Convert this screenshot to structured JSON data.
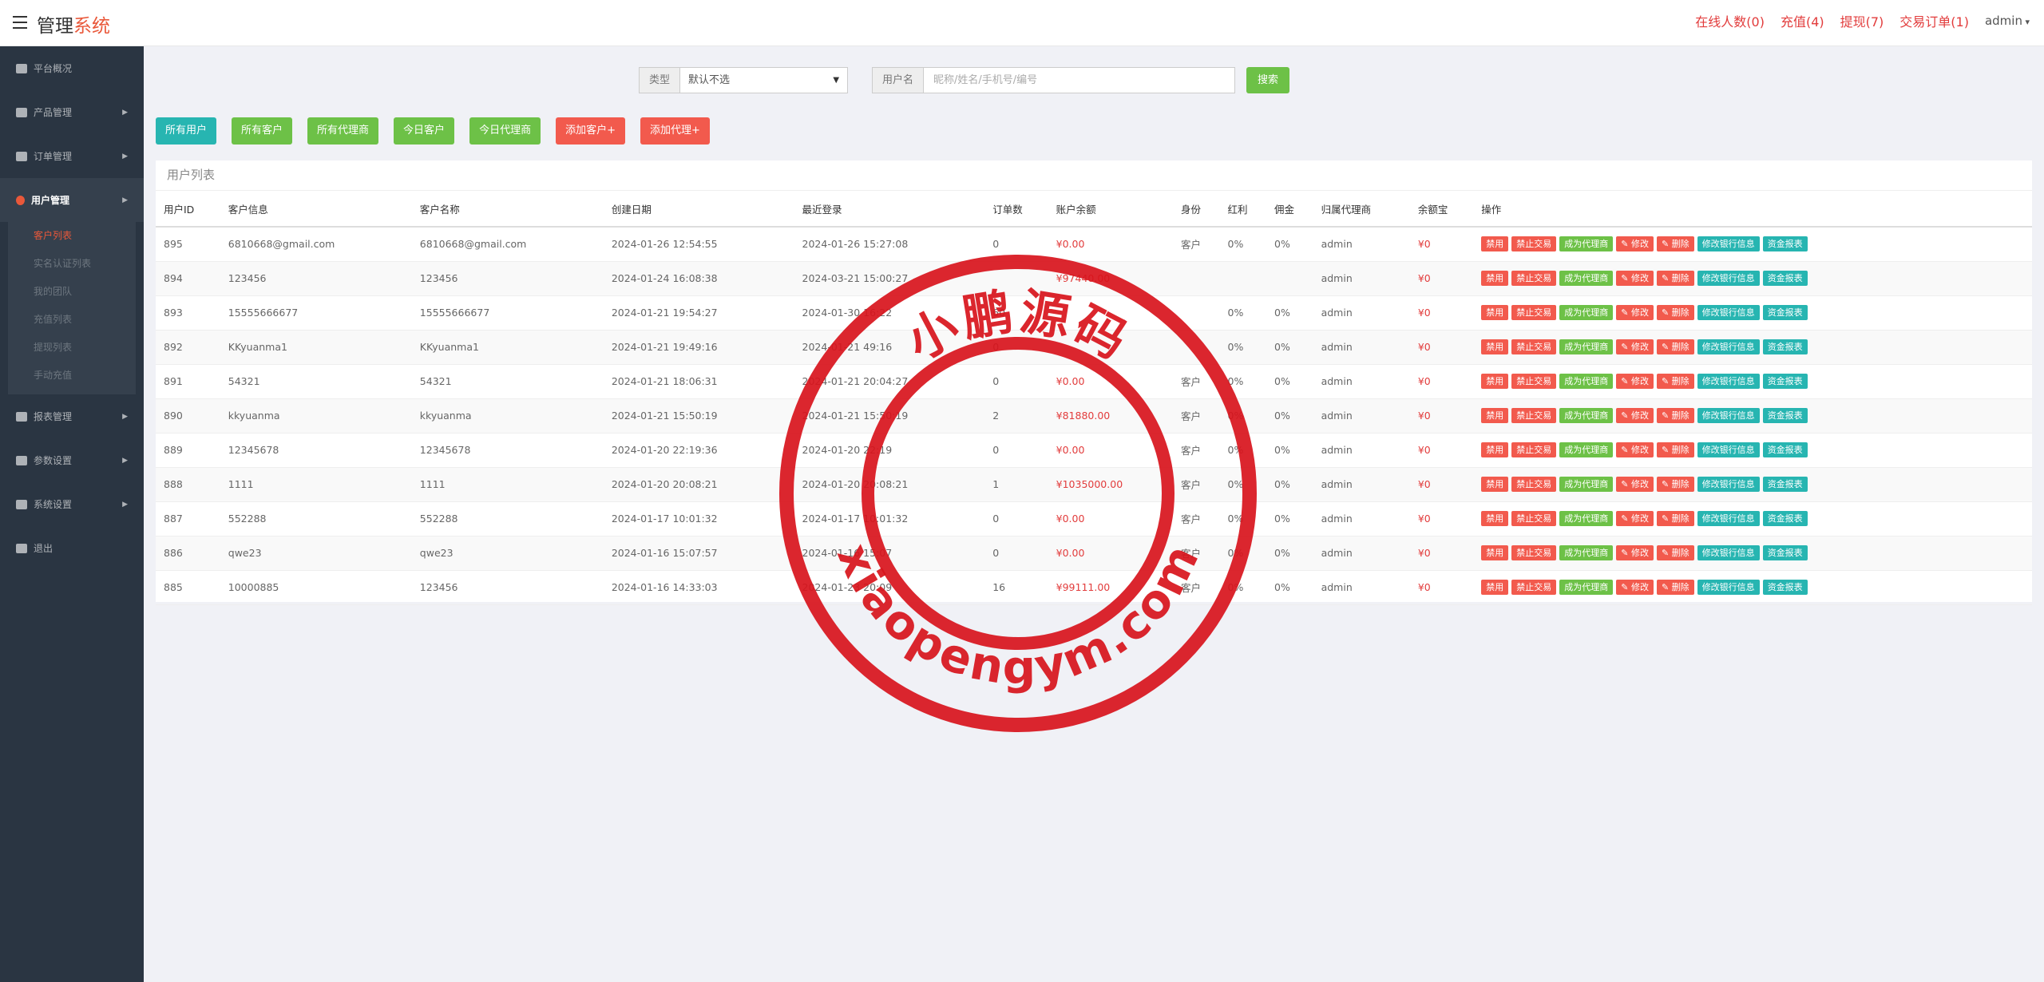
{
  "brand": {
    "main": "管理",
    "accent": "系统"
  },
  "top_links": [
    "在线人数(0)",
    "充值(4)",
    "提现(7)",
    "交易订单(1)"
  ],
  "user": "admin",
  "sidebar": [
    {
      "label": "平台概况",
      "icon": "dashboard-icon",
      "caret": false
    },
    {
      "label": "产品管理",
      "icon": "bitcoin-icon",
      "caret": true
    },
    {
      "label": "订单管理",
      "icon": "order-icon",
      "caret": true
    },
    {
      "label": "用户管理",
      "icon": "user-icon",
      "caret": true,
      "active": true,
      "children": [
        "客户列表",
        "实名认证列表",
        "我的团队",
        "充值列表",
        "提现列表",
        "手动充值"
      ]
    },
    {
      "label": "报表管理",
      "icon": "yen-icon",
      "caret": true
    },
    {
      "label": "参数设置",
      "icon": "params-icon",
      "caret": true
    },
    {
      "label": "系统设置",
      "icon": "gears-icon",
      "caret": true
    },
    {
      "label": "退出",
      "icon": "logout-icon",
      "caret": false
    }
  ],
  "search": {
    "type_label": "类型",
    "type_value": "默认不选",
    "name_label": "用户名",
    "name_placeholder": "昵称/姓名/手机号/编号",
    "button": "搜索"
  },
  "filters": [
    {
      "label": "所有用户",
      "color": "#27b5b1"
    },
    {
      "label": "所有客户",
      "color": "#6dc147"
    },
    {
      "label": "所有代理商",
      "color": "#6dc147"
    },
    {
      "label": "今日客户",
      "color": "#6dc147"
    },
    {
      "label": "今日代理商",
      "color": "#6dc147"
    },
    {
      "label": "添加客户+",
      "color": "#f25a4d"
    },
    {
      "label": "添加代理+",
      "color": "#f25a4d"
    }
  ],
  "table": {
    "title": "用户列表",
    "columns": [
      "用户ID",
      "客户信息",
      "客户名称",
      "创建日期",
      "最近登录",
      "订单数",
      "账户余额",
      "身份",
      "红利",
      "佣金",
      "归属代理商",
      "余额宝",
      "操作"
    ],
    "actions": [
      {
        "label": "禁用",
        "color": "#f25a4d"
      },
      {
        "label": "禁止交易",
        "color": "#f25a4d"
      },
      {
        "label": "成为代理商",
        "color": "#6dc147"
      },
      {
        "label": "✎ 修改",
        "color": "#f25a4d"
      },
      {
        "label": "✎ 删除",
        "color": "#f25a4d"
      },
      {
        "label": "修改银行信息",
        "color": "#27b5b1"
      },
      {
        "label": "资金报表",
        "color": "#27b5b1"
      }
    ],
    "rows": [
      [
        "895",
        "6810668@gmail.com",
        "6810668@gmail.com",
        "2024-01-26 12:54:55",
        "2024-01-26 15:27:08",
        "0",
        "¥0.00",
        "客户",
        "0%",
        "0%",
        "admin",
        "¥0"
      ],
      [
        "894",
        "123456",
        "123456",
        "2024-01-24 16:08:38",
        "2024-03-21 15:00:27",
        "",
        "¥97440.00",
        "",
        "",
        "",
        "admin",
        "¥0"
      ],
      [
        "893",
        "15555666677",
        "15555666677",
        "2024-01-21 19:54:27",
        "2024-01-30 16:22",
        "60",
        "",
        "",
        "0%",
        "0%",
        "admin",
        "¥0"
      ],
      [
        "892",
        "KKyuanma1",
        "KKyuanma1",
        "2024-01-21 19:49:16",
        "2024-01-21 49:16",
        "0",
        "",
        "",
        "0%",
        "0%",
        "admin",
        "¥0"
      ],
      [
        "891",
        "54321",
        "54321",
        "2024-01-21 18:06:31",
        "2024-01-21 20:04:27",
        "0",
        "¥0.00",
        "客户",
        "0%",
        "0%",
        "admin",
        "¥0"
      ],
      [
        "890",
        "kkyuanma",
        "kkyuanma",
        "2024-01-21 15:50:19",
        "2024-01-21 15:50:19",
        "2",
        "¥81880.00",
        "客户",
        "0%",
        "0%",
        "admin",
        "¥0"
      ],
      [
        "889",
        "12345678",
        "12345678",
        "2024-01-20 22:19:36",
        "2024-01-20 22:19",
        "0",
        "¥0.00",
        "客户",
        "0%",
        "0%",
        "admin",
        "¥0"
      ],
      [
        "888",
        "1111",
        "1111",
        "2024-01-20 20:08:21",
        "2024-01-20 20:08:21",
        "1",
        "¥1035000.00",
        "客户",
        "0%",
        "0%",
        "admin",
        "¥0"
      ],
      [
        "887",
        "552288",
        "552288",
        "2024-01-17 10:01:32",
        "2024-01-17 10:01:32",
        "0",
        "¥0.00",
        "客户",
        "0%",
        "0%",
        "admin",
        "¥0"
      ],
      [
        "886",
        "qwe23",
        "qwe23",
        "2024-01-16 15:07:57",
        "2024-01-16 15:07",
        "0",
        "¥0.00",
        "客户",
        "0%",
        "0%",
        "admin",
        "¥0"
      ],
      [
        "885",
        "10000885",
        "123456",
        "2024-01-16 14:33:03",
        "2024-01-23 20:09",
        "16",
        "¥99111.00",
        "客户",
        "0%",
        "0%",
        "admin",
        "¥0"
      ]
    ]
  },
  "watermark": {
    "top": "小鹏源码",
    "bottom": "xiaopengym.com",
    "color": "#d8141c"
  }
}
